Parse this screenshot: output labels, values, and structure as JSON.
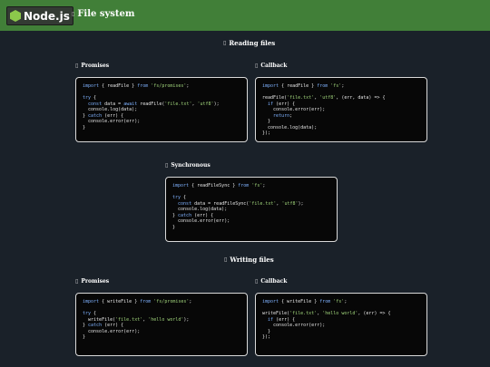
{
  "header": {
    "logo_text": "Node.js",
    "title": "File system",
    "title_icon": "file-icon"
  },
  "sections": [
    {
      "title": "Reading files",
      "icon": "file-icon",
      "blocks": [
        {
          "title": "Promises",
          "lines": [
            [
              [
                "kw",
                "import"
              ],
              [
                "t",
                " { readFile } "
              ],
              [
                "kw",
                "from"
              ],
              [
                "t",
                " "
              ],
              [
                "str",
                "'fs/promises'"
              ],
              [
                "t",
                ";"
              ]
            ],
            [],
            [
              [
                "kw",
                "try"
              ],
              [
                "t",
                " {"
              ]
            ],
            [
              [
                "t",
                "  "
              ],
              [
                "kw",
                "const"
              ],
              [
                "t",
                " data = "
              ],
              [
                "kw",
                "await"
              ],
              [
                "t",
                " readFile("
              ],
              [
                "str",
                "'file.txt'"
              ],
              [
                "t",
                ", "
              ],
              [
                "str",
                "'utf8'"
              ],
              [
                "t",
                ");"
              ]
            ],
            [
              [
                "t",
                "  console.log(data);"
              ]
            ],
            [
              [
                "t",
                "} "
              ],
              [
                "kw",
                "catch"
              ],
              [
                "t",
                " (err) {"
              ]
            ],
            [
              [
                "t",
                "  console.error(err);"
              ]
            ],
            [
              [
                "t",
                "}"
              ]
            ]
          ]
        },
        {
          "title": "Callback",
          "lines": [
            [
              [
                "kw",
                "import"
              ],
              [
                "t",
                " { readFile } "
              ],
              [
                "kw",
                "from"
              ],
              [
                "t",
                " "
              ],
              [
                "str",
                "'fs'"
              ],
              [
                "t",
                ";"
              ]
            ],
            [],
            [
              [
                "t",
                "readFile("
              ],
              [
                "str",
                "'file.txt'"
              ],
              [
                "t",
                ", "
              ],
              [
                "str",
                "'utf8'"
              ],
              [
                "t",
                ", (err, data) => {"
              ]
            ],
            [
              [
                "t",
                "  "
              ],
              [
                "kw",
                "if"
              ],
              [
                "t",
                " (err) {"
              ]
            ],
            [
              [
                "t",
                "    console.error(err);"
              ]
            ],
            [
              [
                "t",
                "    "
              ],
              [
                "kw",
                "return"
              ],
              [
                "t",
                ";"
              ]
            ],
            [
              [
                "t",
                "  }"
              ]
            ],
            [
              [
                "t",
                "  console.log(data);"
              ]
            ],
            [
              [
                "t",
                "});"
              ]
            ]
          ]
        },
        {
          "title": "Synchronous",
          "lines": [
            [
              [
                "kw",
                "import"
              ],
              [
                "t",
                " { readFileSync } "
              ],
              [
                "kw",
                "from"
              ],
              [
                "t",
                " "
              ],
              [
                "str",
                "'fs'"
              ],
              [
                "t",
                ";"
              ]
            ],
            [],
            [
              [
                "kw",
                "try"
              ],
              [
                "t",
                " {"
              ]
            ],
            [
              [
                "t",
                "  "
              ],
              [
                "kw",
                "const"
              ],
              [
                "t",
                " data = readFileSync("
              ],
              [
                "str",
                "'file.txt'"
              ],
              [
                "t",
                ", "
              ],
              [
                "str",
                "'utf8'"
              ],
              [
                "t",
                ");"
              ]
            ],
            [
              [
                "t",
                "  console.log(data);"
              ]
            ],
            [
              [
                "t",
                "} "
              ],
              [
                "kw",
                "catch"
              ],
              [
                "t",
                " (err) {"
              ]
            ],
            [
              [
                "t",
                "  console.error(err);"
              ]
            ],
            [
              [
                "t",
                "}"
              ]
            ]
          ]
        }
      ]
    },
    {
      "title": "Writing files",
      "icon": "file-icon",
      "blocks": [
        {
          "title": "Promises",
          "lines": [
            [
              [
                "kw",
                "import"
              ],
              [
                "t",
                " { writeFile } "
              ],
              [
                "kw",
                "from"
              ],
              [
                "t",
                " "
              ],
              [
                "str",
                "'fs/promises'"
              ],
              [
                "t",
                ";"
              ]
            ],
            [],
            [
              [
                "kw",
                "try"
              ],
              [
                "t",
                " {"
              ]
            ],
            [
              [
                "t",
                "  writeFile("
              ],
              [
                "str",
                "'file.txt'"
              ],
              [
                "t",
                ", "
              ],
              [
                "str",
                "'hello world'"
              ],
              [
                "t",
                ");"
              ]
            ],
            [
              [
                "t",
                "} "
              ],
              [
                "kw",
                "catch"
              ],
              [
                "t",
                " (err) {"
              ]
            ],
            [
              [
                "t",
                "  console.error(err);"
              ]
            ],
            [
              [
                "t",
                "}"
              ]
            ]
          ]
        },
        {
          "title": "Callback",
          "lines": [
            [
              [
                "kw",
                "import"
              ],
              [
                "t",
                " { writeFile } "
              ],
              [
                "kw",
                "from"
              ],
              [
                "t",
                " "
              ],
              [
                "str",
                "'fs'"
              ],
              [
                "t",
                ";"
              ]
            ],
            [],
            [
              [
                "t",
                "writeFile("
              ],
              [
                "str",
                "'file.txt'"
              ],
              [
                "t",
                ", "
              ],
              [
                "str",
                "'hello world'"
              ],
              [
                "t",
                ", (err) => {"
              ]
            ],
            [
              [
                "t",
                "  "
              ],
              [
                "kw",
                "if"
              ],
              [
                "t",
                " (err) {"
              ]
            ],
            [
              [
                "t",
                "    console.error(err);"
              ]
            ],
            [
              [
                "t",
                "  }"
              ]
            ],
            [
              [
                "t",
                "});"
              ]
            ]
          ]
        }
      ]
    }
  ],
  "colors": {
    "header": "#417f38",
    "background": "#1a2129",
    "code_bg": "#070707",
    "keyword": "#7fb2ff",
    "string": "#9fd37a"
  }
}
